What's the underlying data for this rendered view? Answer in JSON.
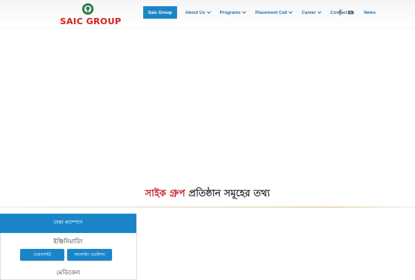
{
  "brand": {
    "logo_text": "SAIC GROUP"
  },
  "nav": {
    "items": [
      {
        "label": "Saic Group"
      },
      {
        "label": "About Us"
      },
      {
        "label": "Programs"
      },
      {
        "label": "Placement Cell"
      },
      {
        "label": "Career"
      },
      {
        "label": "Contact Us"
      },
      {
        "label": "News"
      }
    ],
    "social": [
      "facebook-icon",
      "youtube-icon"
    ]
  },
  "banner": {
    "title_red": "সাইক গ্রুপ",
    "title_rest": "প্রতিষ্ঠান সমূহের তথ্য"
  },
  "campus": {
    "header": "ঢাকা ক্যাম্পাস",
    "sections": [
      {
        "title": "ইঞ্জিনিয়ারিং",
        "website_button": "ওয়েবসাইট",
        "admission_button": "অনলাইন এডমিশন"
      },
      {
        "title": "মেডিকেল"
      }
    ]
  },
  "colors": {
    "accent": "#1a86c8",
    "brand_red": "#d62020",
    "nav_text": "#1f6fb0"
  }
}
